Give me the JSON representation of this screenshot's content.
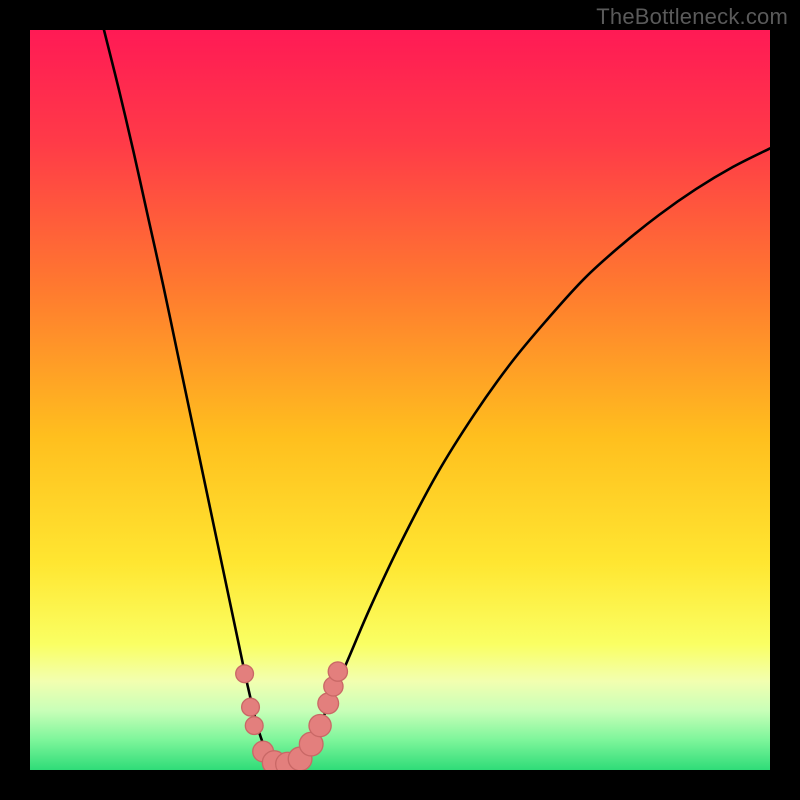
{
  "watermark": "TheBottleneck.com",
  "colors": {
    "frame": "#000000",
    "gradient_stops": [
      {
        "offset": 0.0,
        "color": "#ff1a55"
      },
      {
        "offset": 0.15,
        "color": "#ff3a48"
      },
      {
        "offset": 0.35,
        "color": "#ff7a2f"
      },
      {
        "offset": 0.55,
        "color": "#ffbf1e"
      },
      {
        "offset": 0.72,
        "color": "#ffe631"
      },
      {
        "offset": 0.83,
        "color": "#faff63"
      },
      {
        "offset": 0.88,
        "color": "#f2ffb0"
      },
      {
        "offset": 0.92,
        "color": "#c8ffb8"
      },
      {
        "offset": 0.96,
        "color": "#7cf59a"
      },
      {
        "offset": 1.0,
        "color": "#2fdc78"
      }
    ],
    "curve": "#000000",
    "dot_fill": "#e37f7d",
    "dot_stroke": "#c96866"
  },
  "chart_data": {
    "type": "line",
    "title": "",
    "xlabel": "",
    "ylabel": "",
    "xlim": [
      0,
      100
    ],
    "ylim": [
      0,
      100
    ],
    "x_optimum": 33,
    "series": [
      {
        "name": "bottleneck-curve",
        "points": [
          {
            "x": 10.0,
            "y": 100.0
          },
          {
            "x": 12.0,
            "y": 92.0
          },
          {
            "x": 14.0,
            "y": 83.5
          },
          {
            "x": 16.0,
            "y": 74.5
          },
          {
            "x": 18.0,
            "y": 65.5
          },
          {
            "x": 20.0,
            "y": 56.0
          },
          {
            "x": 22.0,
            "y": 46.5
          },
          {
            "x": 24.0,
            "y": 37.0
          },
          {
            "x": 26.0,
            "y": 27.5
          },
          {
            "x": 28.0,
            "y": 18.0
          },
          {
            "x": 29.5,
            "y": 11.0
          },
          {
            "x": 31.0,
            "y": 5.0
          },
          {
            "x": 32.5,
            "y": 1.5
          },
          {
            "x": 34.0,
            "y": 0.5
          },
          {
            "x": 36.0,
            "y": 1.0
          },
          {
            "x": 38.0,
            "y": 3.5
          },
          {
            "x": 40.0,
            "y": 8.0
          },
          {
            "x": 43.0,
            "y": 15.0
          },
          {
            "x": 46.0,
            "y": 22.0
          },
          {
            "x": 50.0,
            "y": 30.5
          },
          {
            "x": 55.0,
            "y": 40.0
          },
          {
            "x": 60.0,
            "y": 48.0
          },
          {
            "x": 65.0,
            "y": 55.0
          },
          {
            "x": 70.0,
            "y": 61.0
          },
          {
            "x": 75.0,
            "y": 66.5
          },
          {
            "x": 80.0,
            "y": 71.0
          },
          {
            "x": 85.0,
            "y": 75.0
          },
          {
            "x": 90.0,
            "y": 78.5
          },
          {
            "x": 95.0,
            "y": 81.5
          },
          {
            "x": 100.0,
            "y": 84.0
          }
        ]
      }
    ],
    "dots": [
      {
        "x": 29.0,
        "y": 13.0,
        "r": 1.2
      },
      {
        "x": 29.8,
        "y": 8.5,
        "r": 1.2
      },
      {
        "x": 30.3,
        "y": 6.0,
        "r": 1.2
      },
      {
        "x": 31.5,
        "y": 2.5,
        "r": 1.4
      },
      {
        "x": 33.0,
        "y": 1.0,
        "r": 1.6
      },
      {
        "x": 34.8,
        "y": 0.8,
        "r": 1.6
      },
      {
        "x": 36.5,
        "y": 1.5,
        "r": 1.6
      },
      {
        "x": 38.0,
        "y": 3.5,
        "r": 1.6
      },
      {
        "x": 39.2,
        "y": 6.0,
        "r": 1.5
      },
      {
        "x": 40.3,
        "y": 9.0,
        "r": 1.4
      },
      {
        "x": 41.0,
        "y": 11.3,
        "r": 1.3
      },
      {
        "x": 41.6,
        "y": 13.3,
        "r": 1.3
      }
    ]
  }
}
